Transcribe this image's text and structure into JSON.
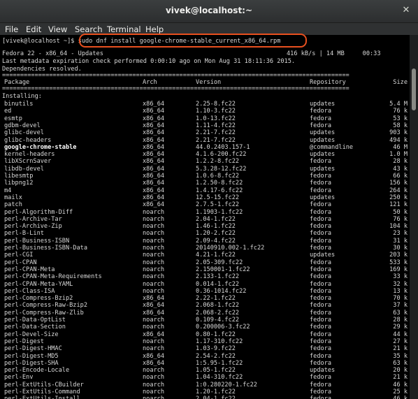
{
  "window": {
    "title": "vivek@localhost:~",
    "close_symbol": "✕"
  },
  "menu": [
    "File",
    "Edit",
    "View",
    "Search",
    "Terminal",
    "Help"
  ],
  "terminal": {
    "prompt": "[vivek@localhost ~]$ ",
    "command": "sudo dnf install google-chrome-stable_current_x86_64.rpm",
    "repo_line": "Fedora 22 - x86_64 - Updates",
    "speed": "416 kB/s | 14 MB     00:33",
    "meta_line": "Last metadata expiration check performed 0:00:10 ago on Mon Aug 31 18:11:36 2015.",
    "deps_line": "Dependencies resolved.",
    "separator": "================================================================================================",
    "headers": {
      "package": "Package",
      "arch": "Arch",
      "version": "Version",
      "repository": "Repository",
      "size": "Size"
    },
    "installing_label": "Installing:",
    "packages": [
      {
        "name": "binutils",
        "arch": "x86_64",
        "version": "2.25-8.fc22",
        "repo": "updates",
        "size": "5.4 M"
      },
      {
        "name": "ed",
        "arch": "x86_64",
        "version": "1.10-3.fc22",
        "repo": "fedora",
        "size": "76 k"
      },
      {
        "name": "esmtp",
        "arch": "x86_64",
        "version": "1.0-13.fc22",
        "repo": "fedora",
        "size": "53 k"
      },
      {
        "name": "gdbm-devel",
        "arch": "x86_64",
        "version": "1.11-4.fc22",
        "repo": "fedora",
        "size": "58 k"
      },
      {
        "name": "glibc-devel",
        "arch": "x86_64",
        "version": "2.21-7.fc22",
        "repo": "updates",
        "size": "903 k"
      },
      {
        "name": "glibc-headers",
        "arch": "x86_64",
        "version": "2.21-7.fc22",
        "repo": "updates",
        "size": "494 k"
      },
      {
        "name": "google-chrome-stable",
        "arch": "x86_64",
        "version": "44.0.2403.157-1",
        "repo": "@commandline",
        "size": "46 M",
        "bold": true
      },
      {
        "name": "kernel-headers",
        "arch": "x86_64",
        "version": "4.1.6-200.fc22",
        "repo": "updates",
        "size": "1.0 M"
      },
      {
        "name": "libXScrnSaver",
        "arch": "x86_64",
        "version": "1.2.2-8.fc22",
        "repo": "fedora",
        "size": "28 k"
      },
      {
        "name": "libdb-devel",
        "arch": "x86_64",
        "version": "5.3.28-12.fc22",
        "repo": "updates",
        "size": "43 k"
      },
      {
        "name": "libesmtp",
        "arch": "x86_64",
        "version": "1.0.6-8.fc22",
        "repo": "fedora",
        "size": "66 k"
      },
      {
        "name": "libpng12",
        "arch": "x86_64",
        "version": "1.2.50-8.fc22",
        "repo": "fedora",
        "size": "156 k"
      },
      {
        "name": "m4",
        "arch": "x86_64",
        "version": "1.4.17-6.fc22",
        "repo": "fedora",
        "size": "264 k"
      },
      {
        "name": "mailx",
        "arch": "x86_64",
        "version": "12.5-15.fc22",
        "repo": "updates",
        "size": "250 k"
      },
      {
        "name": "patch",
        "arch": "x86_64",
        "version": "2.7.5-1.fc22",
        "repo": "fedora",
        "size": "121 k"
      },
      {
        "name": "perl-Algorithm-Diff",
        "arch": "noarch",
        "version": "1.1903-1.fc22",
        "repo": "fedora",
        "size": "50 k"
      },
      {
        "name": "perl-Archive-Tar",
        "arch": "noarch",
        "version": "2.04-1.fc22",
        "repo": "fedora",
        "size": "76 k"
      },
      {
        "name": "perl-Archive-Zip",
        "arch": "noarch",
        "version": "1.46-1.fc22",
        "repo": "fedora",
        "size": "104 k"
      },
      {
        "name": "perl-B-Lint",
        "arch": "noarch",
        "version": "1.20-2.fc22",
        "repo": "fedora",
        "size": "23 k"
      },
      {
        "name": "perl-Business-ISBN",
        "arch": "noarch",
        "version": "2.09-4.fc22",
        "repo": "fedora",
        "size": "31 k"
      },
      {
        "name": "perl-Business-ISBN-Data",
        "arch": "noarch",
        "version": "20140910.002-1.fc22",
        "repo": "fedora",
        "size": "30 k"
      },
      {
        "name": "perl-CGI",
        "arch": "noarch",
        "version": "4.21-1.fc22",
        "repo": "updates",
        "size": "203 k"
      },
      {
        "name": "perl-CPAN",
        "arch": "noarch",
        "version": "2.05-309.fc22",
        "repo": "fedora",
        "size": "533 k"
      },
      {
        "name": "perl-CPAN-Meta",
        "arch": "noarch",
        "version": "2.150001-1.fc22",
        "repo": "fedora",
        "size": "169 k"
      },
      {
        "name": "perl-CPAN-Meta-Requirements",
        "arch": "noarch",
        "version": "2.133-1.fc22",
        "repo": "fedora",
        "size": "33 k"
      },
      {
        "name": "perl-CPAN-Meta-YAML",
        "arch": "noarch",
        "version": "0.014-1.fc22",
        "repo": "fedora",
        "size": "32 k"
      },
      {
        "name": "perl-Class-ISA",
        "arch": "noarch",
        "version": "0.36-1014.fc22",
        "repo": "fedora",
        "size": "13 k"
      },
      {
        "name": "perl-Compress-Bzip2",
        "arch": "x86_64",
        "version": "2.22-1.fc22",
        "repo": "fedora",
        "size": "70 k"
      },
      {
        "name": "perl-Compress-Raw-Bzip2",
        "arch": "x86_64",
        "version": "2.068-1.fc22",
        "repo": "fedora",
        "size": "37 k"
      },
      {
        "name": "perl-Compress-Raw-Zlib",
        "arch": "x86_64",
        "version": "2.068-2.fc22",
        "repo": "fedora",
        "size": "63 k"
      },
      {
        "name": "perl-Data-OptList",
        "arch": "noarch",
        "version": "0.109-4.fc22",
        "repo": "fedora",
        "size": "28 k"
      },
      {
        "name": "perl-Data-Section",
        "arch": "noarch",
        "version": "0.200006-3.fc22",
        "repo": "fedora",
        "size": "29 k"
      },
      {
        "name": "perl-Devel-Size",
        "arch": "x86_64",
        "version": "0.80-1.fc22",
        "repo": "fedora",
        "size": "44 k"
      },
      {
        "name": "perl-Digest",
        "arch": "noarch",
        "version": "1.17-310.fc22",
        "repo": "fedora",
        "size": "27 k"
      },
      {
        "name": "perl-Digest-HMAC",
        "arch": "noarch",
        "version": "1.03-9.fc22",
        "repo": "fedora",
        "size": "21 k"
      },
      {
        "name": "perl-Digest-MD5",
        "arch": "x86_64",
        "version": "2.54-2.fc22",
        "repo": "fedora",
        "size": "35 k"
      },
      {
        "name": "perl-Digest-SHA",
        "arch": "x86_64",
        "version": "1:5.95-1.fc22",
        "repo": "fedora",
        "size": "63 k"
      },
      {
        "name": "perl-Encode-Locale",
        "arch": "noarch",
        "version": "1.05-1.fc22",
        "repo": "updates",
        "size": "20 k"
      },
      {
        "name": "perl-Env",
        "arch": "noarch",
        "version": "1.04-310.fc22",
        "repo": "fedora",
        "size": "21 k"
      },
      {
        "name": "perl-ExtUtils-CBuilder",
        "arch": "noarch",
        "version": "1:0.280220-1.fc22",
        "repo": "fedora",
        "size": "46 k"
      },
      {
        "name": "perl-ExtUtils-Command",
        "arch": "noarch",
        "version": "1.20-1.fc22",
        "repo": "fedora",
        "size": "25 k"
      },
      {
        "name": "perl-ExtUtils-Install",
        "arch": "noarch",
        "version": "2.04-1.fc22",
        "repo": "fedora",
        "size": "46 k"
      }
    ]
  }
}
